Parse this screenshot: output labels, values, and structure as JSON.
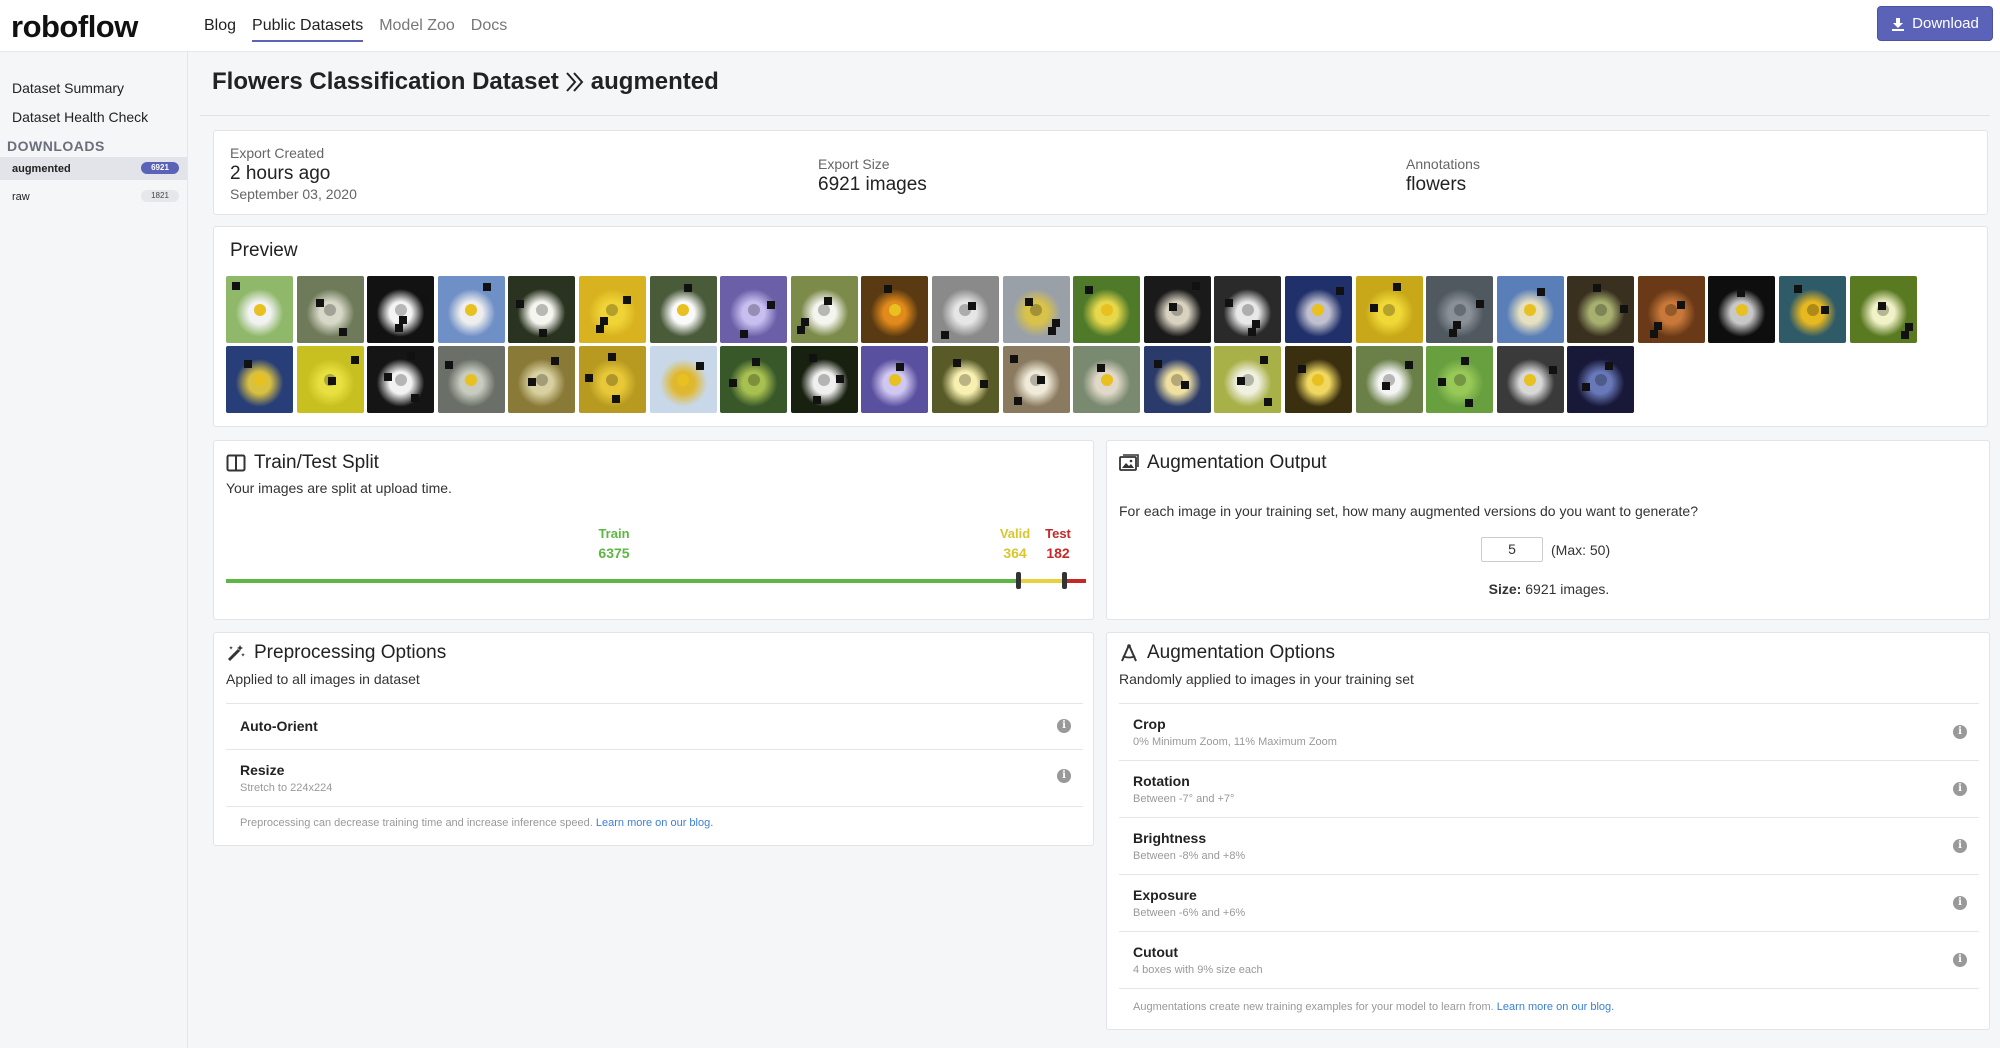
{
  "app": {
    "logo": "roboflow",
    "nav": [
      "Blog",
      "Public Datasets",
      "Model Zoo",
      "Docs"
    ],
    "download_label": "Download"
  },
  "sidebar": {
    "links": [
      "Dataset Summary",
      "Dataset Health Check"
    ],
    "downloads_heading": "DOWNLOADS",
    "versions": [
      {
        "label": "augmented",
        "count": "6921",
        "selected": true
      },
      {
        "label": "raw",
        "count": "1821",
        "selected": false
      }
    ]
  },
  "page": {
    "dataset": "Flowers Classification Dataset",
    "version": "augmented"
  },
  "export": {
    "created_label": "Export Created",
    "created_value": "2 hours ago",
    "created_date": "September 03, 2020",
    "size_label": "Export Size",
    "size_value": "6921 images",
    "annotations_label": "Annotations",
    "annotations_value": "flowers"
  },
  "preview": {
    "title": "Preview",
    "image_count": 44
  },
  "split": {
    "title": "Train/Test Split",
    "subtitle": "Your images are split at upload time.",
    "train_label": "Train",
    "train_value": "6375",
    "valid_label": "Valid",
    "valid_value": "364",
    "test_label": "Test",
    "test_value": "182",
    "train_fraction": 0.921,
    "valid_fraction": 0.053,
    "test_fraction": 0.026,
    "colors": {
      "train": "#5cb842",
      "valid": "#e6d23a",
      "test": "#c62828"
    }
  },
  "augmentation_output": {
    "title": "Augmentation Output",
    "question": "For each image in your training set, how many augmented versions do you want to generate?",
    "input_value": "5",
    "max_label": "(Max: 50)",
    "size_label": "Size:",
    "size_value": " 6921 images."
  },
  "preprocessing": {
    "title": "Preprocessing Options",
    "subtitle": "Applied to all images in dataset",
    "options": [
      {
        "name": "Auto-Orient",
        "desc": ""
      },
      {
        "name": "Resize",
        "desc": "Stretch to 224x224"
      }
    ],
    "footer": "Preprocessing can decrease training time and increase inference speed. ",
    "footer_link": "Learn more on our blog."
  },
  "augmentation_options": {
    "title": "Augmentation Options",
    "subtitle": "Randomly applied to images in your training set",
    "options": [
      {
        "name": "Crop",
        "desc": "0% Minimum Zoom, 11% Maximum Zoom"
      },
      {
        "name": "Rotation",
        "desc": "Between -7° and +7°"
      },
      {
        "name": "Brightness",
        "desc": "Between -8% and +8%"
      },
      {
        "name": "Exposure",
        "desc": "Between -6% and +6%"
      },
      {
        "name": "Cutout",
        "desc": "4 boxes with 9% size each"
      }
    ],
    "footer": "Augmentations create new training examples for your model to learn from. ",
    "footer_link": "Learn more on our blog."
  },
  "colors": {
    "accent": "#5b63b8",
    "link": "#3b7fd6"
  }
}
